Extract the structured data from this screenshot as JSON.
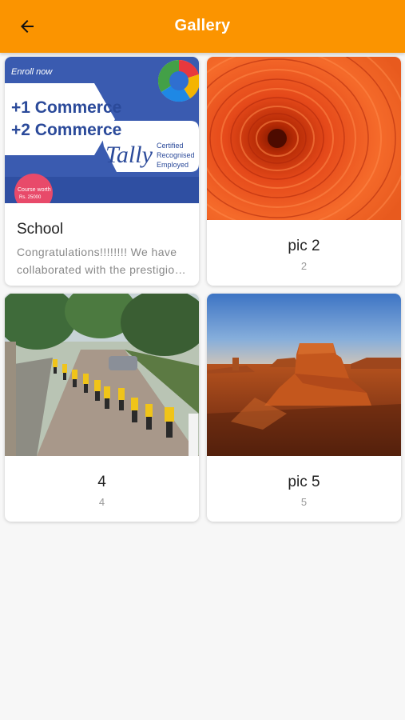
{
  "app_bar": {
    "title": "Gallery",
    "back_icon": "arrow-back-icon",
    "color": "#fb9400"
  },
  "gallery": [
    {
      "title": "School",
      "description": "Congratulations!!!!!!!! We have collaborated with the prestigious Tally Education",
      "image": {
        "enroll": "Enroll now",
        "line1": "+1 Commerce",
        "line2": "+2 Commerce",
        "brand": "Tally",
        "cert1": "Certified",
        "cert2": "Recognised",
        "cert3": "Employed",
        "course1": "Course worth",
        "course2": "Rs. 25000"
      }
    },
    {
      "title": "pic 2",
      "description": "2",
      "image_alt": "orange chrysanthemum flower"
    },
    {
      "title": "4",
      "description": "4",
      "image_alt": "students walking on a village road"
    },
    {
      "title": "pic 5",
      "description": "5",
      "image_alt": "desert butte at sunset"
    }
  ]
}
